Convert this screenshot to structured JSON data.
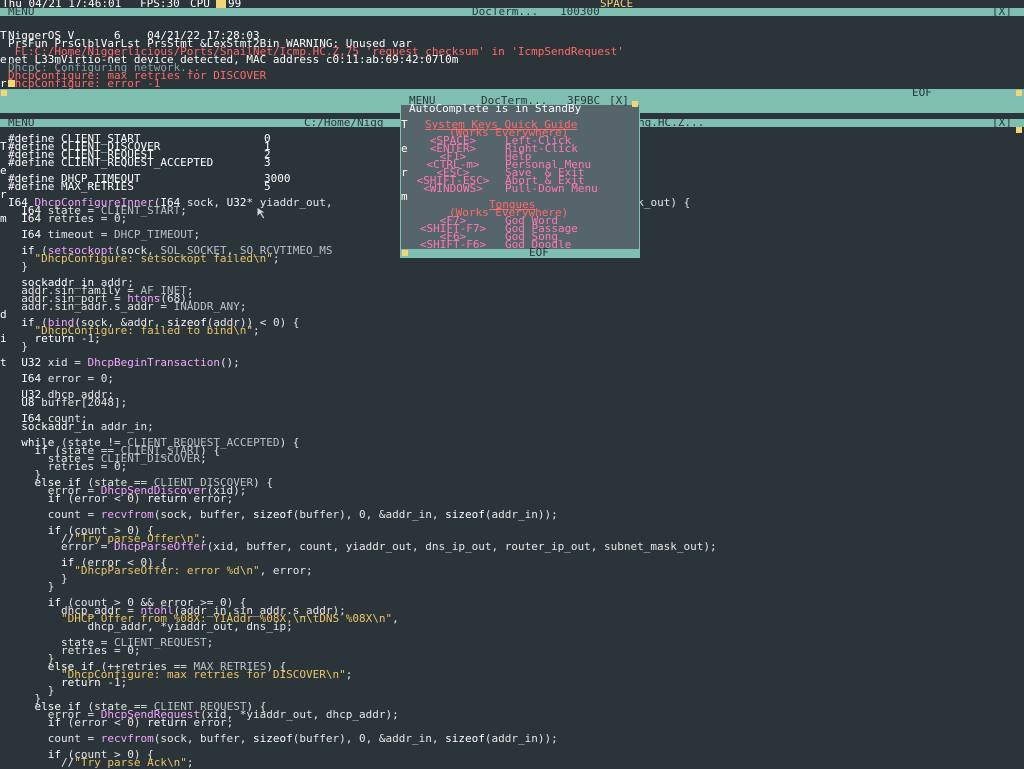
{
  "status": {
    "date": "Thu 04/21 17:46:01",
    "fps": "FPS:30",
    "cpu": "CPU",
    "cpu_val": "99",
    "space_label": "SPACE"
  },
  "top_win": {
    "menu": "MENU",
    "title": "DocTerm...",
    "counter": "100300",
    "close": "[X]",
    "eof": "EOF",
    "lines": [
      {
        "t": "NiggerOS V      6    04/21/22 17:28:03",
        "c": "white"
      },
      {
        "t": "PrsFun PrsGlblVarLst PrsStmt &LexStmt2Bin WARNING: Unused var",
        "c": "white"
      },
      {
        "t": " FL:C:/Home/Niggerlicious/Ports/SnailNet/Icmp.HC.Z,75 'request_checksum' in 'IcmpSendRequest'",
        "c": "red"
      },
      {
        "t": "net L33mVirtio-net device detected, MAC address c0:11:ab:69:42:07l0m",
        "c": "white"
      },
      {
        "t": "DhcpC: Configuring network...",
        "c": "dim"
      },
      {
        "t": "DhcpConfigure: max retries for DISCOVER",
        "c": "red"
      },
      {
        "t": "DhcpConfigure: error -1",
        "c": "red"
      }
    ],
    "left_col": [
      "T",
      "e",
      "r",
      "m",
      "",
      "",
      "",
      ""
    ]
  },
  "main_win": {
    "menu": "MENU",
    "title": "C:/Home/Nigg",
    "title_end": "ng.HC.Z...",
    "close": "[X]",
    "left_col": [
      "T",
      "e",
      "r",
      "m",
      "",
      "",
      "",
      "d",
      "i",
      "t"
    ],
    "defines": [
      {
        "name": "#define CLIENT_START",
        "val": "0"
      },
      {
        "name": "#define CLIENT_DISCOVER",
        "val": "1"
      },
      {
        "name": "#define CLIENT_REQUEST",
        "val": "2"
      },
      {
        "name": "#define CLIENT_REQUEST_ACCEPTED",
        "val": "3"
      },
      {
        "name": "",
        "val": ""
      },
      {
        "name": "#define DHCP_TIMEOUT",
        "val": "3000"
      },
      {
        "name": "#define MAX_RETRIES",
        "val": "5"
      }
    ],
    "code": [
      "I64 DhcpConfigureInner(I64 sock, U32* yiaddr_out,                       ip_out, U32* subnet_mask_out) {",
      "  I64 state = CLIENT_START;",
      "  I64 retries = 0;",
      "",
      "  I64 timeout = DHCP_TIMEOUT;",
      "",
      "  if (setsockopt(sock, SOL_SOCKET, SO_RCVTIMEO_MS                               0) {",
      "    \"DhcpConfigure: setsockopt failed\\n\";",
      "  }",
      "",
      "  sockaddr_in addr;",
      "  addr.sin_family = AF_INET;",
      "  addr.sin_port = htons(68);",
      "  addr.sin_addr.s_addr = INADDR_ANY;",
      "",
      "  if (bind(sock, &addr, sizeof(addr)) < 0) {",
      "    \"DhcpConfigure: failed to bind\\n\";",
      "    return -1;",
      "  }",
      "",
      "  U32 xid = DhcpBeginTransaction();",
      "",
      "  I64 error = 0;",
      "",
      "  U32 dhcp_addr;",
      "  U8 buffer[2048];",
      "",
      "  I64 count;",
      "  sockaddr_in addr_in;",
      "",
      "  while (state != CLIENT_REQUEST_ACCEPTED) {",
      "    if (state == CLIENT_START) {",
      "      state = CLIENT_DISCOVER;",
      "      retries = 0;",
      "    }",
      "    else if (state == CLIENT_DISCOVER) {",
      "      error = DhcpSendDiscover(xid);",
      "      if (error < 0) return error;",
      "",
      "      count = recvfrom(sock, buffer, sizeof(buffer), 0, &addr_in, sizeof(addr_in));",
      "",
      "      if (count > 0) {",
      "        //\"Try parse Offer\\n\";",
      "        error = DhcpParseOffer(xid, buffer, count, yiaddr_out, dns_ip_out, router_ip_out, subnet_mask_out);",
      "",
      "        if (error < 0) {",
      "          \"DhcpParseOffer: error %d\\n\", error;",
      "        }",
      "      }",
      "",
      "      if (count > 0 && error >= 0) {",
      "        dhcp_addr = ntohl(addr_in.sin_addr.s_addr);",
      "        \"DHCP Offer from %08X: YIAddr %08X,\\n\\tDNS %08X\\n\",",
      "            dhcp_addr, *yiaddr_out, dns_ip;",
      "",
      "        state = CLIENT_REQUEST;",
      "        retries = 0;",
      "      }",
      "      else if (++retries == MAX_RETRIES) {",
      "        \"DhcpConfigure: max retries for DISCOVER\\n\";",
      "        return -1;",
      "      }",
      "    }",
      "    else if (state == CLIENT_REQUEST) {",
      "      error = DhcpSendRequest(xid, *yiaddr_out, dhcp_addr);",
      "      if (error < 0) return error;",
      "",
      "      count = recvfrom(sock, buffer, sizeof(buffer), 0, &addr_in, sizeof(addr_in));",
      "",
      "      if (count > 0) {",
      "        //\"Try parse Ack\\n\";"
    ]
  },
  "popup": {
    "menu": "MENU",
    "title": "DocTerm...",
    "counter": "3F9BC",
    "close": "[X]",
    "eof": "EOF",
    "left_col": [
      "T",
      "e",
      "r",
      "m"
    ],
    "header": "AutoComplete is in StandBy",
    "guide_title": "System Keys Quick Guide",
    "guide_sub": "(Works Everywhere)",
    "keys": [
      {
        "k": "<SPACE>",
        "v": "Left-Click"
      },
      {
        "k": "<ENTER>",
        "v": "Right-Click"
      },
      {
        "k": "<F1>",
        "v": "Help"
      },
      {
        "k": "<CTRL-m>",
        "v": "Personal Menu"
      },
      {
        "k": "<ESC>",
        "v": "Save  & Exit"
      },
      {
        "k": "<SHIFT-ESC>",
        "v": "Abort & Exit"
      },
      {
        "k": "<WINDOWS>",
        "v": "Pull-Down Menu"
      }
    ],
    "tongues_title": "Tongues",
    "tongues_sub": "(Works Everywhere)",
    "tongues": [
      {
        "k": "<F7>",
        "v": "God Word"
      },
      {
        "k": "<SHIFT-F7>",
        "v": "God Passage"
      },
      {
        "k": "<F6>",
        "v": "God Song"
      },
      {
        "k": "<SHIFT-F6>",
        "v": "God Doodle"
      }
    ]
  }
}
